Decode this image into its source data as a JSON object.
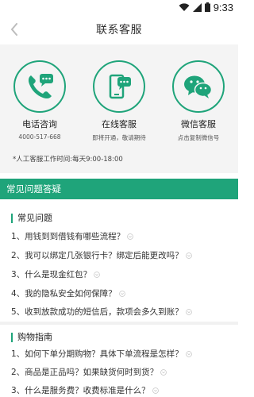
{
  "status_bar": {
    "time": "9:33"
  },
  "header": {
    "title": "联系客服"
  },
  "contacts": [
    {
      "name": "电话咨询",
      "sub": "4000-517-668",
      "icon": "phone-chat-icon"
    },
    {
      "name": "在线客服",
      "sub": "即将开通，敬请期待",
      "icon": "mobile-chat-icon"
    },
    {
      "name": "微信客服",
      "sub": "点击复制微信号",
      "icon": "wechat-icon"
    }
  ],
  "hours": "*人工客服工作时间:每天9:00-18:00",
  "faq_section": {
    "title": "常见问题答疑"
  },
  "groups": [
    {
      "title": "常见问题",
      "items": [
        "1、用钱到到借钱有哪些流程？",
        "2、我可以绑定几张银行卡？绑定后能更改吗？",
        "3、什么是现金红包？",
        "4、我的隐私安全如何保障？",
        "5、收到放款成功的短信后，款项会多久到账？"
      ]
    },
    {
      "title": "购物指南",
      "items": [
        "1、如何下单分期购物？具体下单流程是怎样？",
        "2、商品是正品吗？如果缺货何时到货？",
        "3、什么是服务费？收费标准是什么？"
      ]
    }
  ],
  "colors": {
    "accent": "#1fa47a"
  }
}
